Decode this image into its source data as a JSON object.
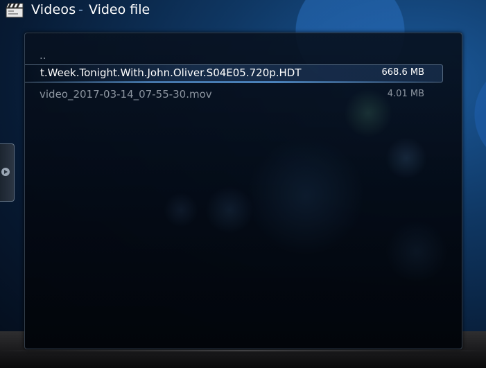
{
  "header": {
    "title": "Videos",
    "separator": "-",
    "subtitle": "Video file",
    "icon": "clapperboard-icon"
  },
  "file_list": {
    "parent": "..",
    "items": [
      {
        "name": "t.Week.Tonight.With.John.Oliver.S04E05.720p.HDT",
        "size": "668.6 MB",
        "focused": true
      },
      {
        "name": "video_2017-03-14_07-55-30.mov",
        "size": "4.01 MB",
        "focused": false
      }
    ]
  },
  "side_tab": {
    "icon": "chevron-right-icon"
  },
  "colors": {
    "accent": "#1b5a9c",
    "text_focused": "#ffffff",
    "text_normal": "#8c95a0"
  }
}
